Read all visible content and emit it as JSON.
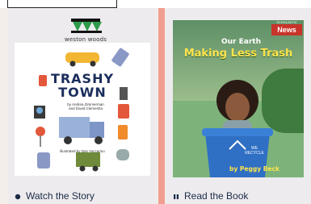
{
  "left_card": {
    "brand_label": "weston woods",
    "book": {
      "title_line1": "TRASHY",
      "title_line2": "TOWN",
      "authors_line1": "by Andrea Zimmerman",
      "authors_line2": "and David Clemesha",
      "illustrator": "illustrated by Dan Yaccarino"
    },
    "caption": "Watch the Story",
    "caption_icon": "play-dot-icon"
  },
  "right_card": {
    "badge_publisher": "SCHOLASTIC",
    "badge_label": "News",
    "series": "Our Earth",
    "title": "Making Less Trash",
    "bin_label": "WE RECYCLE",
    "author": "by Peggy Beck",
    "caption": "Read the Book",
    "caption_icon": "pause-bars-icon"
  },
  "colors": {
    "card_bg": "#edebee",
    "divider": "#ef8f80",
    "caption_text": "#1b2b47",
    "title_blue": "#1a2d5c",
    "title_yellow": "#ffe44d"
  }
}
